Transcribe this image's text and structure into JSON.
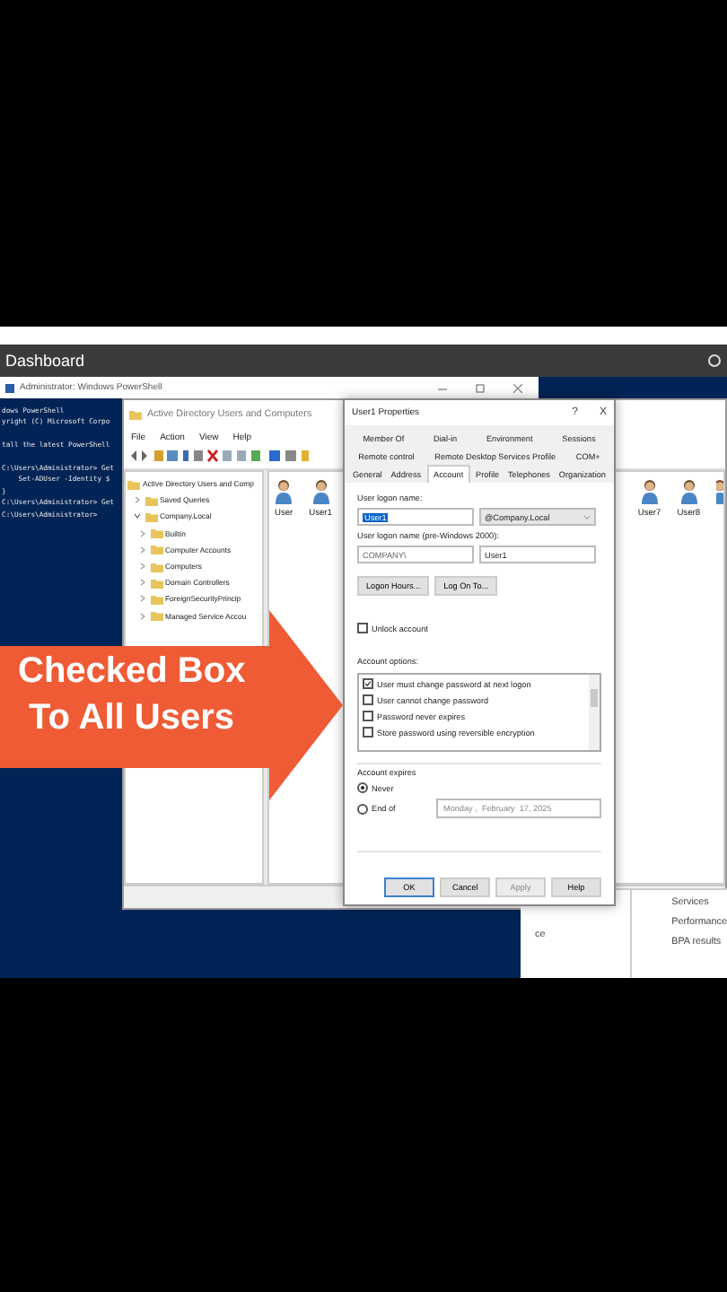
{
  "top_bar": {
    "title": "Dashboard"
  },
  "powershell": {
    "title": "Administrator: Windows PowerShell",
    "lines": [
      {
        "text": "dows PowerShell",
        "gap_before": false
      },
      {
        "text": "yright (C) Microsoft Corpo",
        "gap_before": false
      },
      {
        "text": "tall the latest PowerShell",
        "gap_before": true
      },
      {
        "text": "C:\\Users\\Administrator> Get",
        "gap_before": true
      },
      {
        "text": "    Set-ADUser -Identity $",
        "gap_before": false
      },
      {
        "text": "}",
        "gap_before": false
      },
      {
        "text": "C:\\Users\\Administrator> Get",
        "gap_before": false
      },
      {
        "text": "C:\\Users\\Administrator>",
        "gap_before": false
      }
    ]
  },
  "ad_window": {
    "title": "Active Directory Users and Computers",
    "menu": [
      "File",
      "Action",
      "View",
      "Help"
    ],
    "tree": [
      {
        "label": "Active Directory Users and Comp",
        "children": [
          {
            "label": "Saved Queries",
            "expanded": false
          },
          {
            "label": "Company.Local",
            "expanded": true,
            "children": [
              {
                "label": "Builtin",
                "expanded": false
              },
              {
                "label": "Computer Accounts",
                "expanded": false
              },
              {
                "label": "Computers",
                "expanded": false
              },
              {
                "label": "Domain Controllers",
                "expanded": false
              },
              {
                "label": "ForeignSecurityPrincip",
                "expanded": false
              },
              {
                "label": "Managed Service Accou",
                "expanded": false
              }
            ]
          }
        ]
      }
    ],
    "users_left": [
      "User",
      "User1"
    ],
    "users_right": [
      "User7",
      "User8"
    ]
  },
  "dialog": {
    "title": "User1 Properties",
    "title_buttons": [
      "?",
      "X"
    ],
    "tab_rows": [
      [
        {
          "label": "Member Of",
          "selected": false
        },
        {
          "label": "Dial-in",
          "selected": false
        },
        {
          "label": "Environment",
          "selected": false
        },
        {
          "label": "Sessions",
          "selected": false
        }
      ],
      [
        {
          "label": "Remote control",
          "selected": false
        },
        {
          "label": "Remote Desktop Services Profile",
          "selected": false
        },
        {
          "label": "COM+",
          "selected": false
        }
      ],
      [
        {
          "label": "General",
          "selected": false
        },
        {
          "label": "Address",
          "selected": false
        },
        {
          "label": "Account",
          "selected": true
        },
        {
          "label": "Profile",
          "selected": false
        },
        {
          "label": "Telephones",
          "selected": false
        },
        {
          "label": "Organization",
          "selected": false
        }
      ]
    ],
    "logon_label": "User logon name:",
    "logon_value": "User1",
    "logon_text_selected": true,
    "domain": "@Company.Local",
    "pre2000_label": "User logon name (pre-Windows 2000):",
    "pre2000_domain": "COMPANY\\",
    "pre2000_value": "User1",
    "logon_buttons": [
      "Logon Hours...",
      "Log On To..."
    ],
    "unlock": {
      "label": "Unlock account",
      "checked": false
    },
    "options_label": "Account options:",
    "options": [
      {
        "label": "User must change password at next logon",
        "checked": true
      },
      {
        "label": "User cannot change password",
        "checked": false
      },
      {
        "label": "Password never expires",
        "checked": false
      },
      {
        "label": "Store password using reversible encryption",
        "checked": false
      }
    ],
    "expires_label": "Account expires",
    "expires": [
      {
        "label": "Never",
        "selected": true
      },
      {
        "label": "End of",
        "selected": false
      }
    ],
    "expires_date": "Monday ,  February  17, 2025",
    "buttons": [
      {
        "label": "OK",
        "default": true,
        "disabled": false
      },
      {
        "label": "Cancel",
        "default": false,
        "disabled": false
      },
      {
        "label": "Apply",
        "default": false,
        "disabled": true
      },
      {
        "label": "Help",
        "default": false,
        "disabled": false
      }
    ]
  },
  "server_manager": {
    "fragment": "ce",
    "items": [
      "Services",
      "Performance",
      "BPA results"
    ]
  },
  "callout": {
    "lines": [
      "Checked Box",
      "To All Users"
    ]
  }
}
